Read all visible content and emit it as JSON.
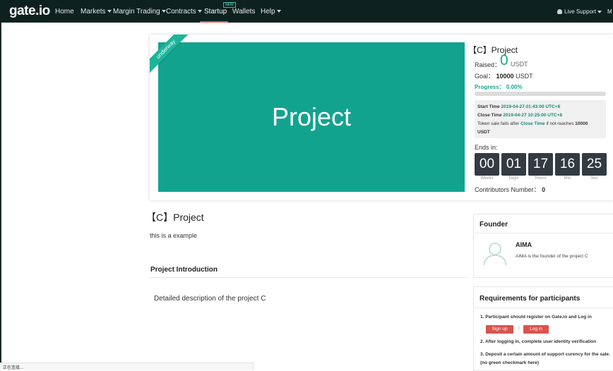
{
  "nav": {
    "logo": "gate.io",
    "items": [
      {
        "label": "Home"
      },
      {
        "label": "Markets"
      },
      {
        "label": "Margin Trading"
      },
      {
        "label": "Contracts"
      },
      {
        "label": "Startup"
      },
      {
        "label": "Wallets"
      },
      {
        "label": "Help"
      }
    ],
    "new_badge": "NEW",
    "support": "Live Support",
    "more": "M"
  },
  "project": {
    "ribbon": "underway",
    "banner_title": "Project",
    "title": "【C】Project",
    "raised_label": "Raised：",
    "raised_value": "0",
    "raised_unit": "USDT",
    "goal_label": "Goal：",
    "goal_value": "10000",
    "goal_unit": "USDT",
    "progress_text": "Progress： 0.00%",
    "progress_fraction": 0.0,
    "start_label": "Start Time",
    "start_value": "2019-04-27 01:43:00 UTC+8",
    "close_label": "Close Time",
    "close_value": "2019-04-27 10:25:00 UTC+8",
    "fail_text_1": "Token sale fails after",
    "fail_close": "Close Time",
    "fail_text_2": "if not reaches",
    "fail_amount_1": "10000",
    "fail_amount_2": "USDT",
    "ends_in": "Ends in:",
    "countdown": [
      {
        "value": "00",
        "label": "Weeks"
      },
      {
        "value": "01",
        "label": "Days"
      },
      {
        "value": "17",
        "label": "Hours"
      },
      {
        "value": "16",
        "label": "Min"
      },
      {
        "value": "25",
        "label": "Sec"
      }
    ],
    "contributors_label": "Contributors Number：",
    "contributors_value": "0"
  },
  "main": {
    "title": "【C】Project",
    "description": "this is a example",
    "intro_heading": "Project Introduction",
    "intro_text": "Detailed description of the project C"
  },
  "founder": {
    "heading": "Founder",
    "name": "AIMA",
    "description": "AIMA is the founder of the project C"
  },
  "requirements": {
    "heading": "Requirements for participants",
    "item1": "1. Participant should register on Gate.io and Log in",
    "signup": "Sign up",
    "separator": "|",
    "login": "Log in",
    "item2": "2. After logging in, complete user identity verification",
    "item3": "3. Deposit a certain amount of support curency for the sale. (no green checkmark here)"
  },
  "status": {
    "text": "正在连接..."
  }
}
